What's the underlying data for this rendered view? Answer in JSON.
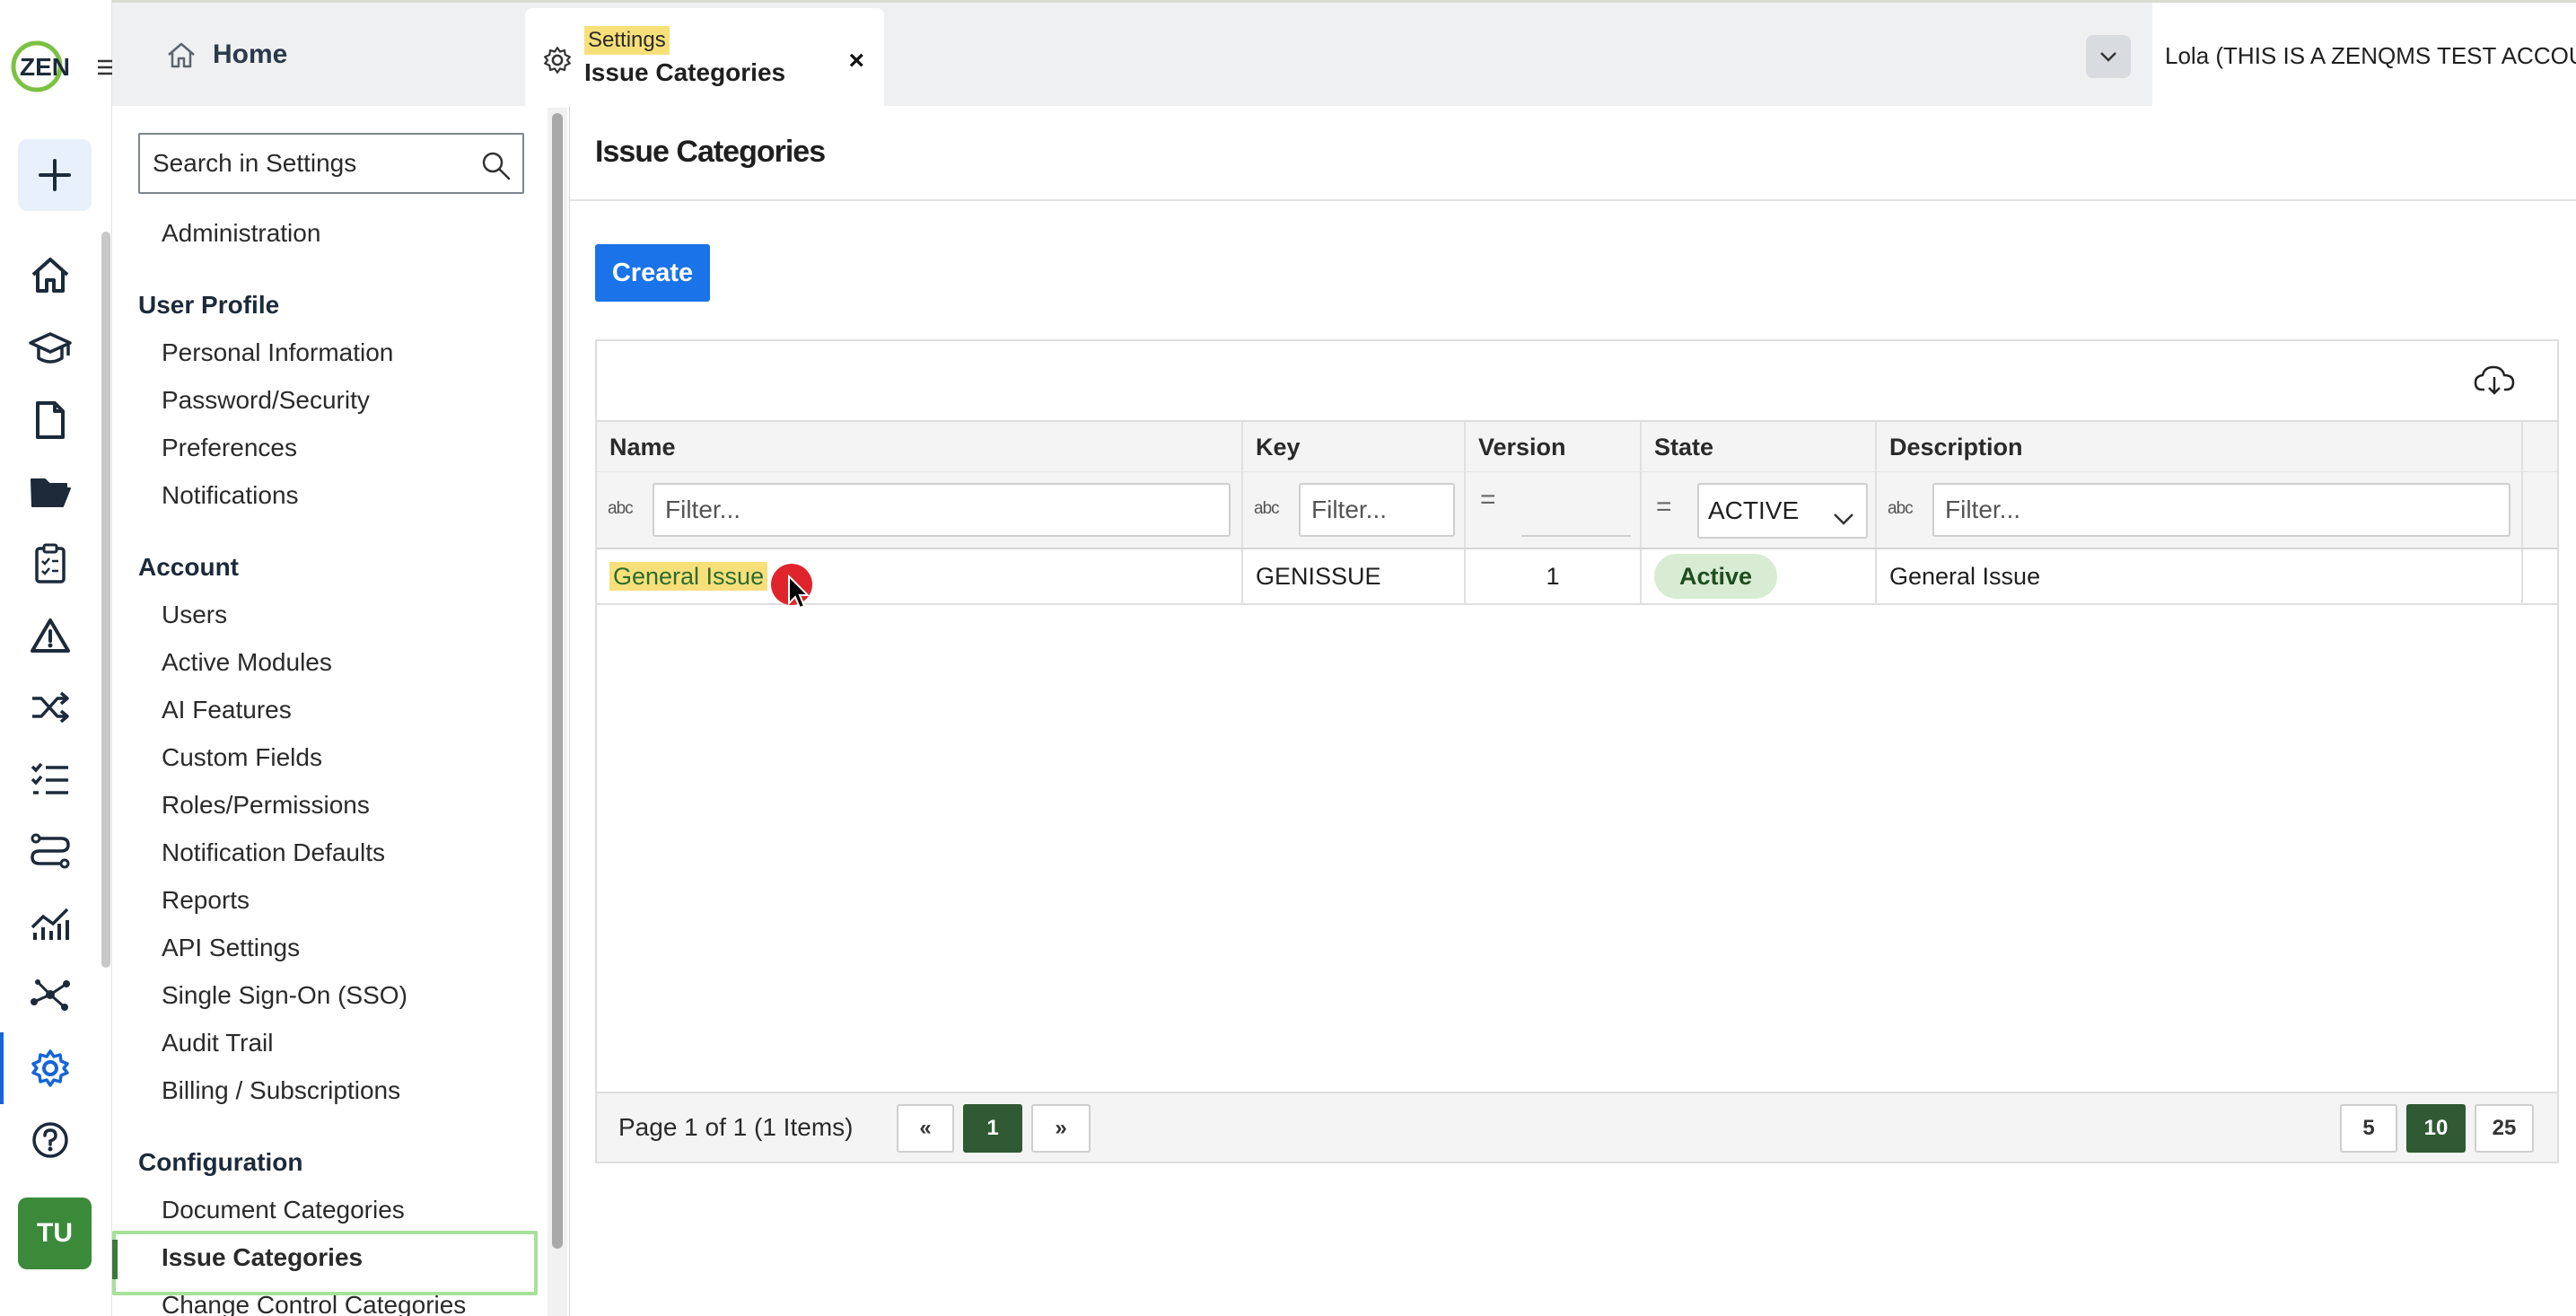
{
  "logo_text": "ZEN",
  "rail": {
    "items": [
      "plus-icon",
      "home-icon",
      "graduation-cap-icon",
      "document-icon",
      "folder-icon",
      "clipboard-icon",
      "warning-icon",
      "shuffle-icon",
      "checklist-icon",
      "route-icon",
      "chart-icon",
      "network-icon",
      "gear-icon",
      "help-icon"
    ],
    "avatar": "TU",
    "accent": "#1565d8"
  },
  "tabs": {
    "home_label": "Home",
    "settings_crumb": "Settings",
    "settings_title": "Issue Categories",
    "close_glyph": "×"
  },
  "account": {
    "name": "Lola (THIS IS A ZENQMS TEST ACCOUNT)"
  },
  "sidebar": {
    "search_placeholder": "Search in Settings",
    "top_item": "Administration",
    "groups": [
      {
        "title": "User Profile",
        "items": [
          "Personal Information",
          "Password/Security",
          "Preferences",
          "Notifications"
        ]
      },
      {
        "title": "Account",
        "items": [
          "Users",
          "Active Modules",
          "AI Features",
          "Custom Fields",
          "Roles/Permissions",
          "Notification Defaults",
          "Reports",
          "API Settings",
          "Single Sign-On (SSO)",
          "Audit Trail",
          "Billing / Subscriptions"
        ]
      },
      {
        "title": "Configuration",
        "items": [
          "Document Categories",
          "Issue Categories",
          "Change Control Categories"
        ]
      }
    ],
    "active_item": "Issue Categories"
  },
  "main": {
    "title": "Issue Categories",
    "create_label": "Create",
    "columns": [
      "Name",
      "Key",
      "Version",
      "State",
      "Description"
    ],
    "filters": {
      "text_placeholder": "Filter...",
      "text_icon": "abc",
      "equals_icon": "=",
      "state_value": "ACTIVE"
    },
    "rows": [
      {
        "name": "General Issue",
        "key": "GENISSUE",
        "version": "1",
        "state": "Active",
        "description": "General Issue"
      }
    ],
    "pager": {
      "info": "Page 1 of 1 (1 Items)",
      "prev": "«",
      "next": "»",
      "current_page": "1",
      "page_sizes": [
        "5",
        "10",
        "25"
      ],
      "selected_size": "10"
    }
  }
}
